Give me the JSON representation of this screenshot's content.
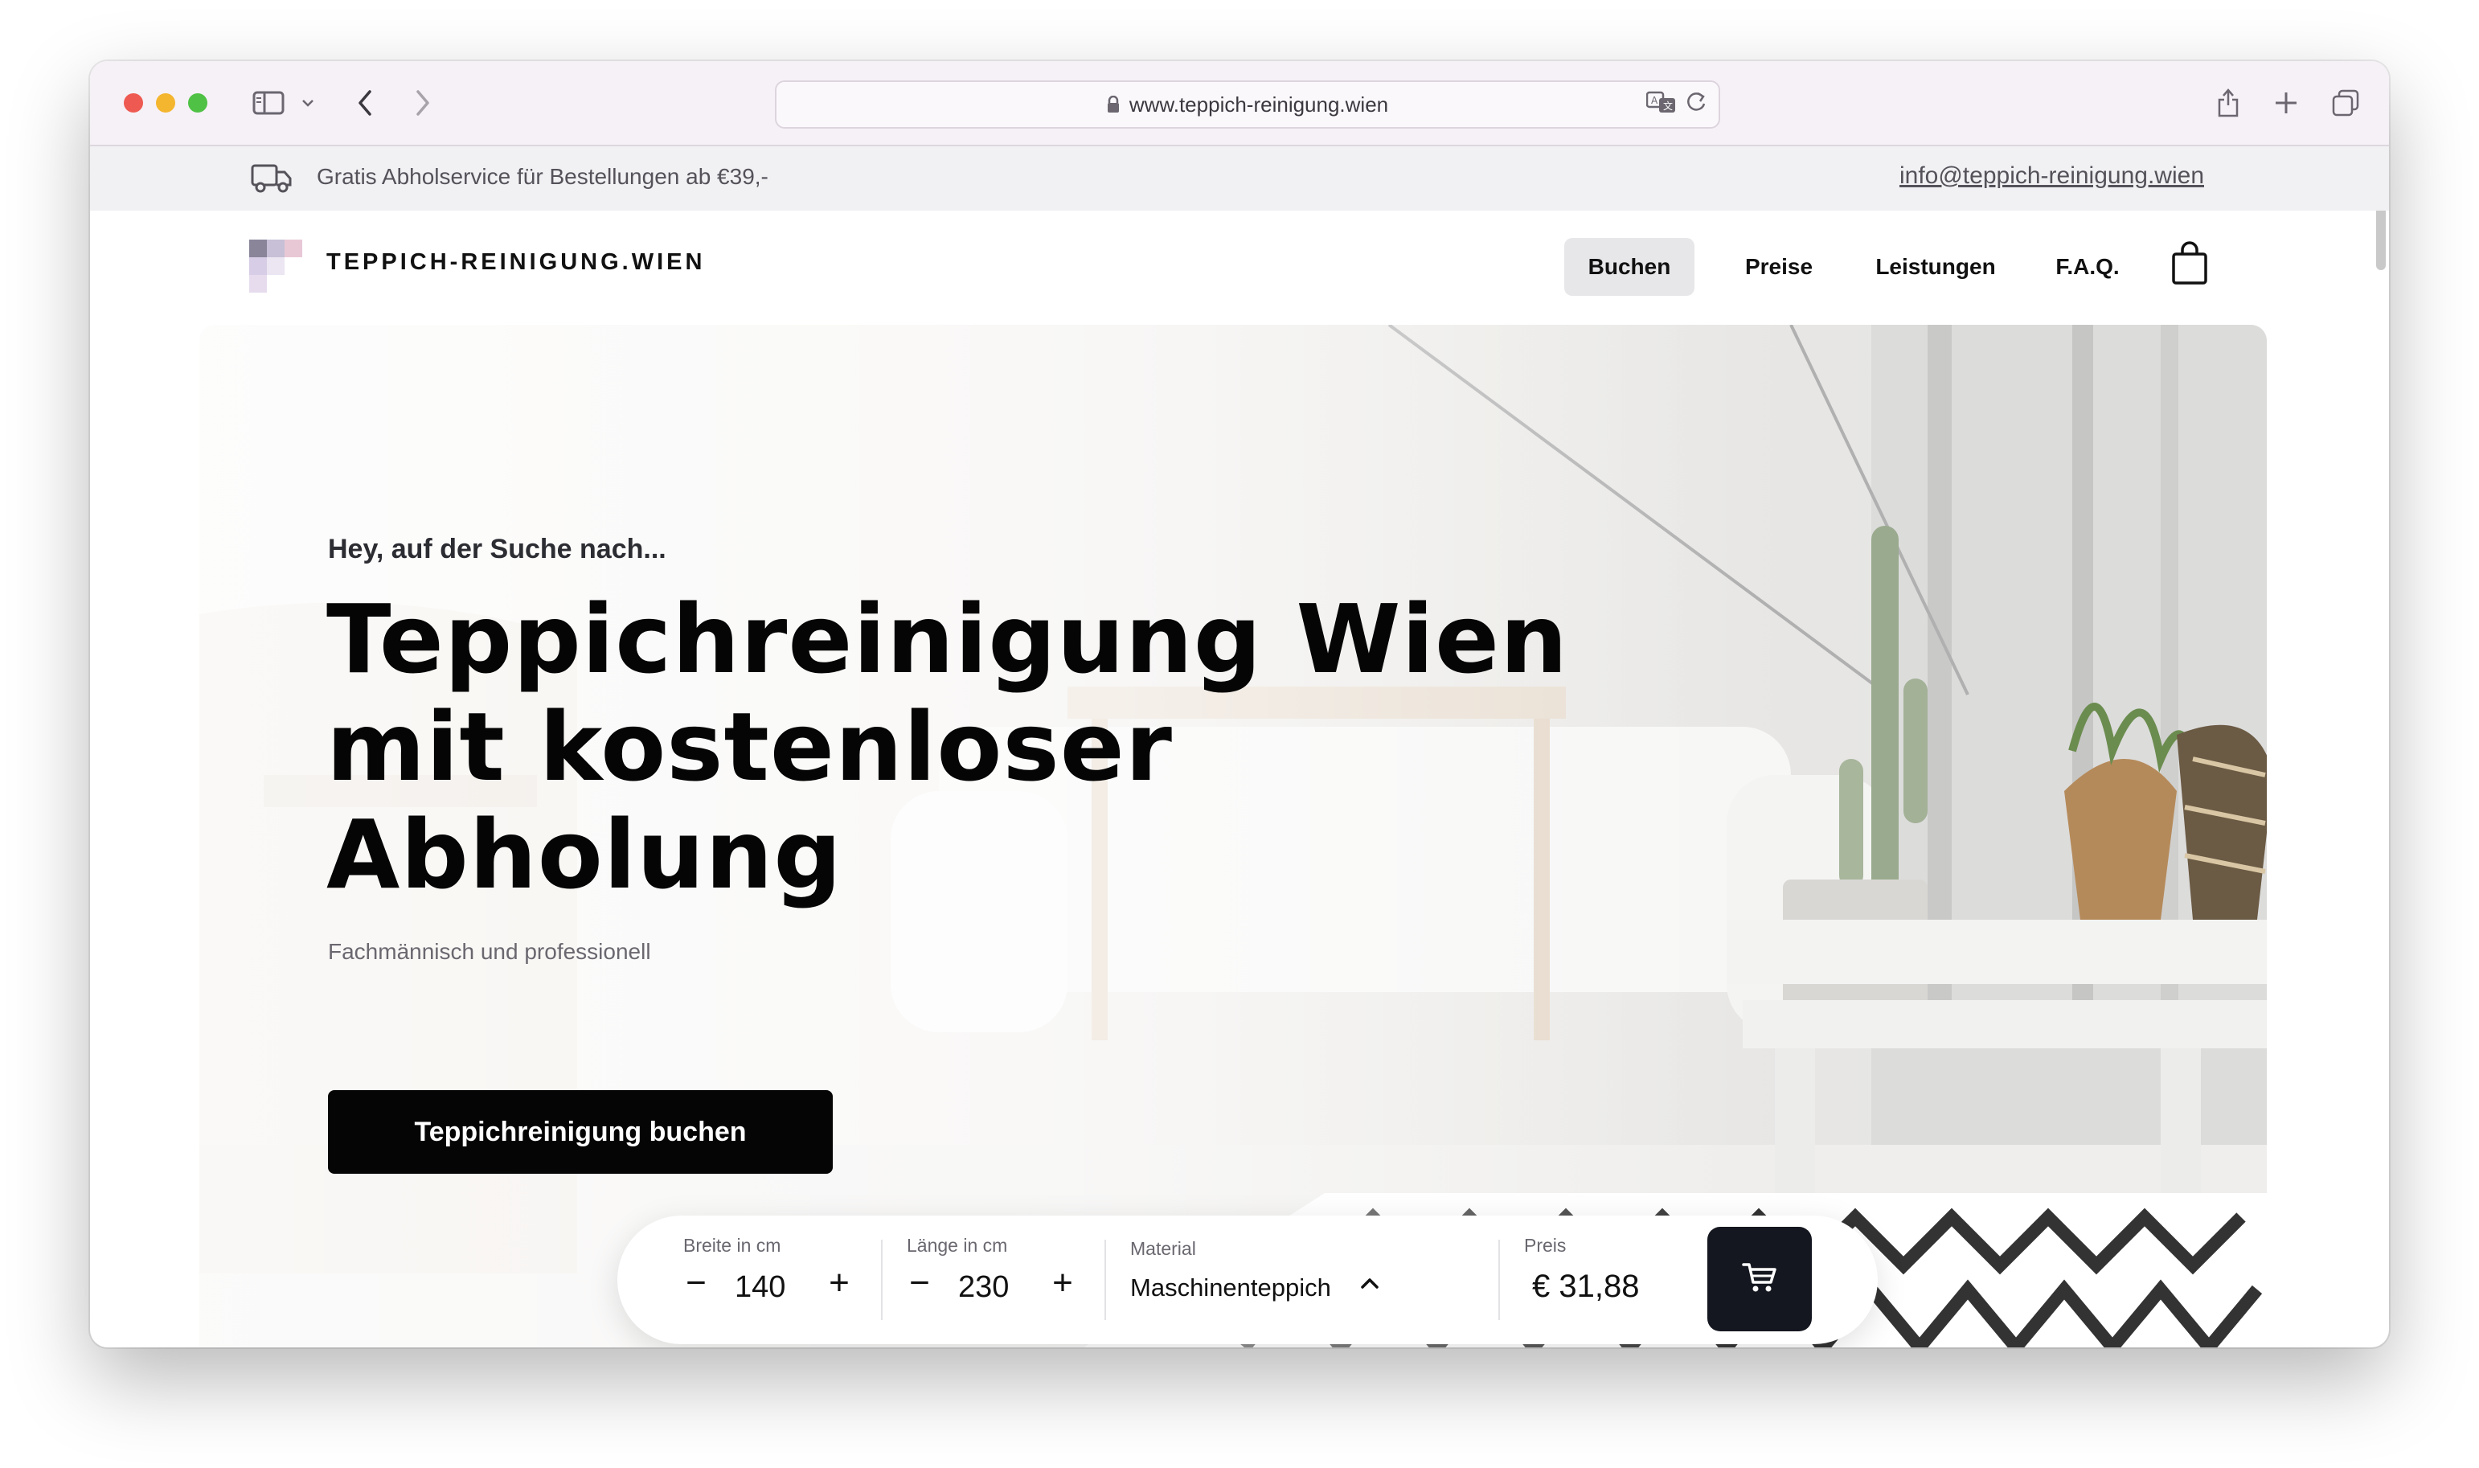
{
  "browser": {
    "url": "www.teppich-reinigung.wien"
  },
  "promo": {
    "text": "Gratis Abholservice für Bestellungen ab €39,-",
    "email": "info@teppich-reinigung.wien"
  },
  "nav": {
    "brand": "TEPPICH-REINIGUNG.WIEN",
    "items": [
      {
        "label": "Buchen",
        "active": true
      },
      {
        "label": "Preise"
      },
      {
        "label": "Leistungen"
      },
      {
        "label": "F.A.Q."
      }
    ]
  },
  "hero": {
    "eyebrow": "Hey, auf der Suche nach...",
    "headline_line1": "Teppichreinigung Wien",
    "headline_line2": "mit kostenloser",
    "headline_line3": "Abholung",
    "subline": "Fachmännisch und professionell",
    "cta": "Teppichreinigung buchen"
  },
  "configurator": {
    "width": {
      "label": "Breite in cm",
      "value": "140",
      "minus": "−",
      "plus": "+"
    },
    "length": {
      "label": "Länge in cm",
      "value": "230",
      "minus": "−",
      "plus": "+"
    },
    "material": {
      "label": "Material",
      "value": "Maschinenteppich"
    },
    "price": {
      "label": "Preis",
      "value": "€ 31,88"
    }
  },
  "colors": {
    "accent": "#050505",
    "cart_button": "#14171f",
    "promo_bg": "#f1f1f3"
  }
}
